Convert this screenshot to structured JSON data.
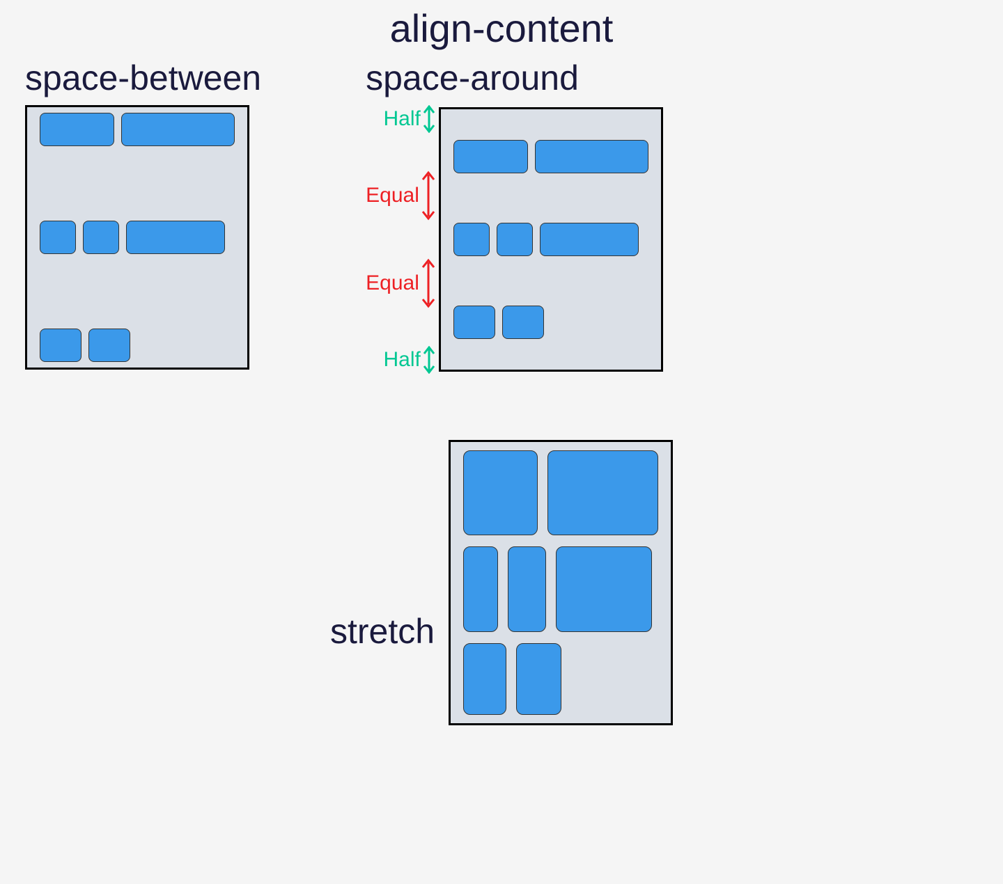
{
  "title": "align-content",
  "examples": {
    "between": {
      "label": "space-between"
    },
    "around": {
      "label": "space-around"
    },
    "stretch": {
      "label": "stretch"
    }
  },
  "annotations": {
    "half": "Half",
    "equal": "Equal"
  }
}
